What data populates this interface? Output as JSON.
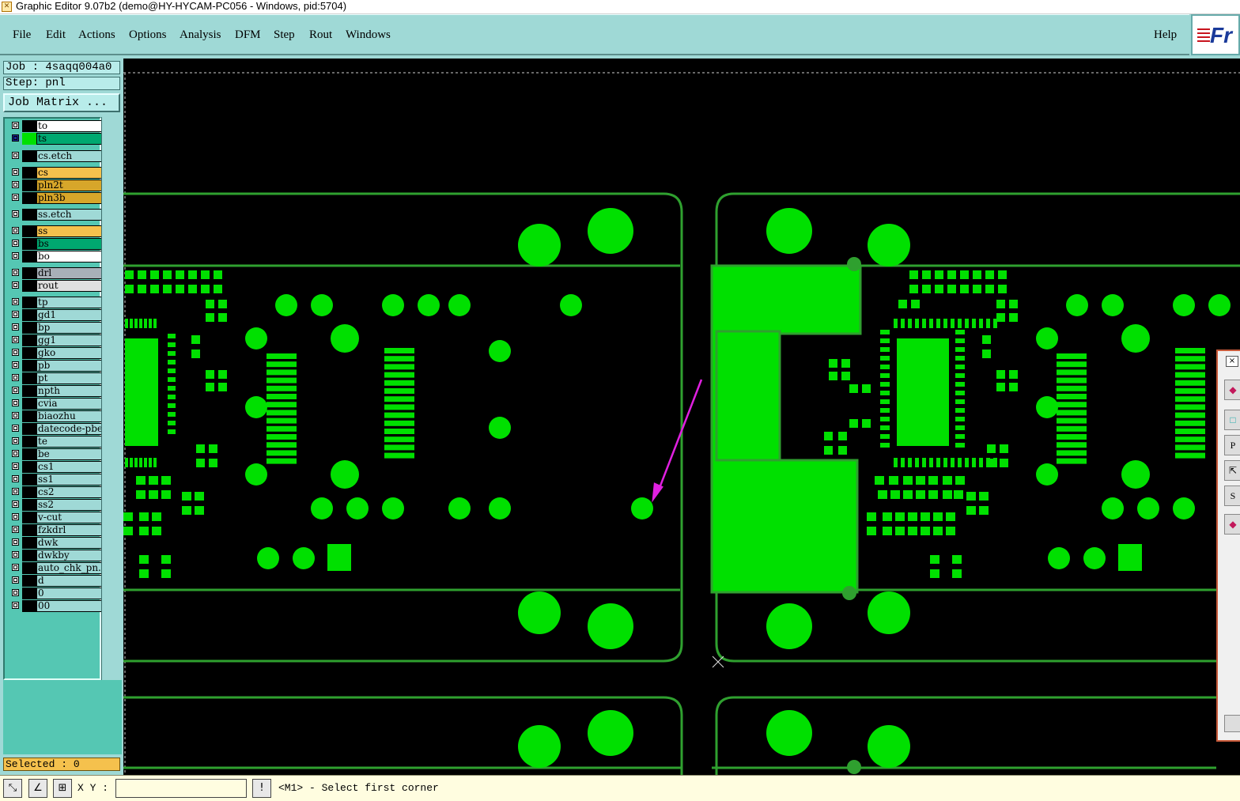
{
  "window": {
    "title": "Graphic Editor 9.07b2 (demo@HY-HYCAM-PC056 - Windows, pid:5704)"
  },
  "menu": {
    "items": [
      "File",
      "Edit",
      "Actions",
      "Options",
      "Analysis",
      "DFM",
      "Step",
      "Rout",
      "Windows"
    ],
    "help": "Help",
    "brand": "Fr"
  },
  "job": {
    "label": "Job : 4saqq004a0",
    "step": "Step: pnl",
    "matrix_button": "Job Matrix ..."
  },
  "layers": [
    {
      "name": "to",
      "color": "#ffffff"
    },
    {
      "name": "ts",
      "color": "#00a870",
      "active": true
    },
    {
      "name": "cs.etch",
      "color": "#9fd9d6"
    },
    {
      "name": "cs",
      "color": "#f5c14d"
    },
    {
      "name": "pln2t",
      "color": "#d7a62a"
    },
    {
      "name": "pln3b",
      "color": "#d7a62a"
    },
    {
      "name": "ss.etch",
      "color": "#9fd9d6"
    },
    {
      "name": "ss",
      "color": "#f5c14d"
    },
    {
      "name": "bs",
      "color": "#00a870"
    },
    {
      "name": "bo",
      "color": "#ffffff"
    },
    {
      "name": "drl",
      "color": "#a8b0b8"
    },
    {
      "name": "rout",
      "color": "#e0e0e0"
    },
    {
      "name": "tp",
      "color": "#9fd9d6"
    },
    {
      "name": "gd1",
      "color": "#9fd9d6"
    },
    {
      "name": "bp",
      "color": "#9fd9d6"
    },
    {
      "name": "gg1",
      "color": "#9fd9d6"
    },
    {
      "name": "gko",
      "color": "#9fd9d6"
    },
    {
      "name": "pb",
      "color": "#9fd9d6"
    },
    {
      "name": "pt",
      "color": "#9fd9d6"
    },
    {
      "name": "npth",
      "color": "#9fd9d6"
    },
    {
      "name": "cvia",
      "color": "#9fd9d6"
    },
    {
      "name": "biaozhu",
      "color": "#9fd9d6"
    },
    {
      "name": "datecode-pbe",
      "color": "#9fd9d6"
    },
    {
      "name": "te",
      "color": "#9fd9d6"
    },
    {
      "name": "be",
      "color": "#9fd9d6"
    },
    {
      "name": "cs1",
      "color": "#9fd9d6"
    },
    {
      "name": "ss1",
      "color": "#9fd9d6"
    },
    {
      "name": "cs2",
      "color": "#9fd9d6"
    },
    {
      "name": "ss2",
      "color": "#9fd9d6"
    },
    {
      "name": "v-cut",
      "color": "#9fd9d6"
    },
    {
      "name": "fzkdrl",
      "color": "#9fd9d6"
    },
    {
      "name": "dwk",
      "color": "#9fd9d6"
    },
    {
      "name": "dwkby",
      "color": "#9fd9d6"
    },
    {
      "name": "auto_chk_pn.",
      "color": "#9fd9d6"
    },
    {
      "name": "d",
      "color": "#9fd9d6"
    },
    {
      "name": "0",
      "color": "#9fd9d6"
    },
    {
      "name": "00",
      "color": "#9fd9d6"
    }
  ],
  "selection": {
    "text": "Selected : 0"
  },
  "status": {
    "xy_label": "X Y :",
    "xy_value": "",
    "prompt": "<M1> - Select first corner"
  },
  "toolbox": {
    "buttons": [
      "P",
      "S"
    ]
  },
  "colors": {
    "board": "#00e000",
    "outline": "#2fa02f",
    "annotation": "#e020e0",
    "panel": "#9fd9d6"
  }
}
